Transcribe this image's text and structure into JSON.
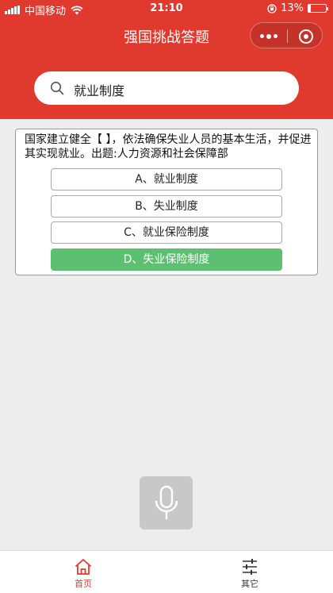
{
  "status_bar": {
    "carrier": "中国移动",
    "time": "21:10",
    "battery_percent": "13%",
    "battery_level": 0.13
  },
  "nav": {
    "title": "强国挑战答题"
  },
  "search": {
    "query": "就业制度",
    "icon": "search-icon"
  },
  "question": {
    "text": "国家建立健全【 】，依法确保失业人员的基本生活，并促进其实现就业。出题:人力资源和社会保障部",
    "options": [
      {
        "label": "A、就业制度",
        "correct": false
      },
      {
        "label": "B、失业制度",
        "correct": false
      },
      {
        "label": "C、就业保险制度",
        "correct": false
      },
      {
        "label": "D、失业保险制度",
        "correct": true
      }
    ]
  },
  "tabs": [
    {
      "label": "首页",
      "icon": "home-icon",
      "active": true
    },
    {
      "label": "其它",
      "icon": "sliders-icon",
      "active": false
    }
  ],
  "colors": {
    "brand_red": "#e03a2f",
    "correct_green": "#5ebf72",
    "active_tab": "#e03a2f",
    "inactive_tab": "#333333"
  }
}
